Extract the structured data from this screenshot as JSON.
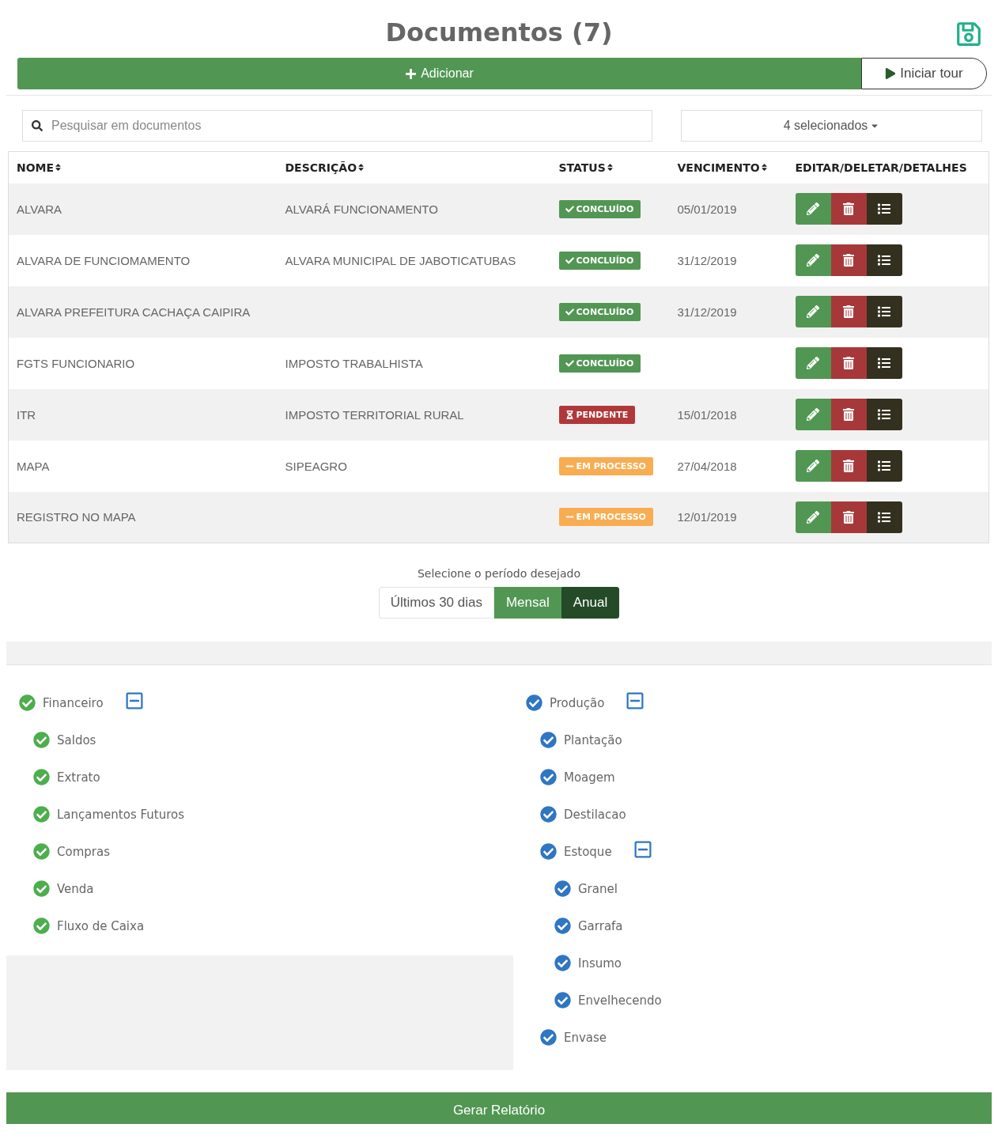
{
  "title": "Documentos (7)",
  "add_button": "Adicionar",
  "tour_button": "Iniciar tour",
  "search": {
    "placeholder": "Pesquisar em documentos"
  },
  "status_filter": {
    "value": "4 selecionados"
  },
  "table": {
    "columns": [
      {
        "label": "NOME",
        "sortable": true
      },
      {
        "label": "DESCRIÇÃO",
        "sortable": true
      },
      {
        "label": "STATUS",
        "sortable": true
      },
      {
        "label": "VENCIMENTO",
        "sortable": true
      },
      {
        "label": "EDITAR/DELETAR/DETALHES",
        "sortable": false
      }
    ],
    "rows": [
      {
        "name": "ALVARA",
        "description": "ALVARÁ FUNCIONAMENTO",
        "status": {
          "kind": "done",
          "label": "CONCLUÍDO"
        },
        "due": "05/01/2019"
      },
      {
        "name": "ALVARA DE FUNCIOMAMENTO",
        "description": "ALVARA MUNICIPAL DE JABOTICATUBAS",
        "status": {
          "kind": "done",
          "label": "CONCLUÍDO"
        },
        "due": "31/12/2019"
      },
      {
        "name": "ALVARA PREFEITURA CACHAÇA CAIPIRA",
        "status": {
          "kind": "done",
          "label": "CONCLUÍDO"
        },
        "due": "31/12/2019"
      },
      {
        "name": "FGTS FUNCIONARIO",
        "description": "IMPOSTO TRABALHISTA",
        "status": {
          "kind": "done",
          "label": "CONCLUÍDO"
        }
      },
      {
        "name": "ITR",
        "description": "IMPOSTO TERRITORIAL RURAL",
        "status": {
          "kind": "pending",
          "label": "PENDENTE"
        },
        "due": "15/01/2018"
      },
      {
        "name": "MAPA",
        "description": "SIPEAGRO",
        "status": {
          "kind": "in_progress",
          "label": "EM PROCESSO"
        },
        "due": "27/04/2018"
      },
      {
        "name": "REGISTRO NO MAPA",
        "status": {
          "kind": "in_progress",
          "label": "EM PROCESSO"
        },
        "due": "12/01/2019"
      }
    ]
  },
  "period": {
    "label": "Selecione o período desejado",
    "options": [
      {
        "label": "Últimos 30 dias",
        "kind": "default",
        "selected": false
      },
      {
        "label": "Mensal",
        "kind": "success",
        "selected": false
      },
      {
        "label": "Anual",
        "kind": "success",
        "selected": true
      }
    ]
  },
  "trees": [
    {
      "label": "Financeiro",
      "checked": true,
      "expanded": true,
      "color": "#4cae4c",
      "children": [
        {
          "label": "Saldos",
          "checked": true
        },
        {
          "label": "Extrato",
          "checked": true
        },
        {
          "label": "Lançamentos Futuros",
          "checked": true
        },
        {
          "label": "Compras",
          "checked": true
        },
        {
          "label": "Venda",
          "checked": true
        },
        {
          "label": "Fluxo de Caixa",
          "checked": true
        }
      ]
    },
    {
      "label": "Produção",
      "checked": true,
      "expanded": true,
      "color": "#2f76c3",
      "children": [
        {
          "label": "Plantação",
          "checked": true
        },
        {
          "label": "Moagem",
          "checked": true
        },
        {
          "label": "Destilacao",
          "checked": true
        },
        {
          "label": "Estoque",
          "checked": true,
          "expanded": true,
          "children": [
            {
              "label": "Granel",
              "checked": true
            },
            {
              "label": "Garrafa",
              "checked": true
            },
            {
              "label": "Insumo",
              "checked": true
            },
            {
              "label": "Envelhecendo",
              "checked": true
            }
          ]
        },
        {
          "label": "Envase",
          "checked": true
        }
      ]
    }
  ],
  "report_button": "Gerar Relatório"
}
